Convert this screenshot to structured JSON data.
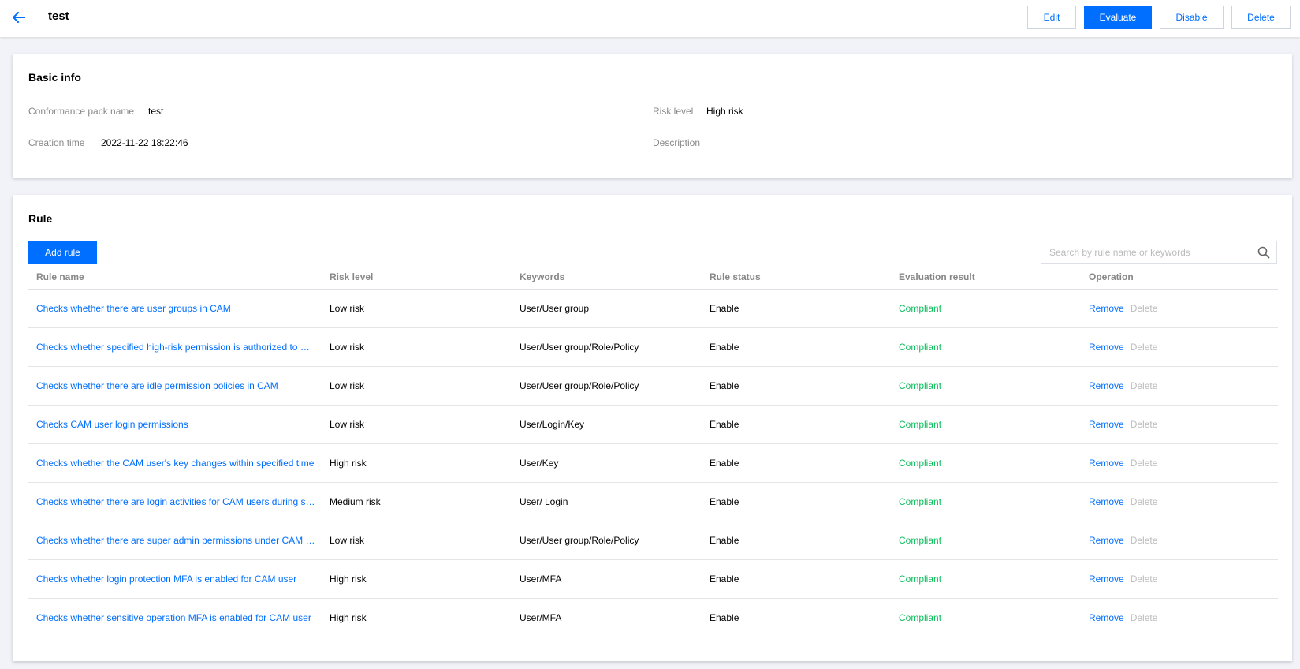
{
  "header": {
    "title": "test",
    "buttons": {
      "edit": "Edit",
      "evaluate": "Evaluate",
      "disable": "Disable",
      "delete": "Delete"
    }
  },
  "basic_info": {
    "title": "Basic info",
    "fields": {
      "pack_name_label": "Conformance pack name",
      "pack_name_value": "test",
      "risk_level_label": "Risk level",
      "risk_level_value": "High risk",
      "creation_time_label": "Creation time",
      "creation_time_value": "2022-11-22 18:22:46",
      "description_label": "Description",
      "description_value": ""
    }
  },
  "rule": {
    "title": "Rule",
    "add_rule_label": "Add rule",
    "search_placeholder": "Search by rule name or keywords",
    "columns": [
      "Rule name",
      "Risk level",
      "Keywords",
      "Rule status",
      "Evaluation result",
      "Operation"
    ],
    "operations": {
      "remove": "Remove",
      "delete": "Delete"
    },
    "rows": [
      {
        "name": "Checks whether there are user groups in CAM",
        "risk": "Low risk",
        "keywords": "User/User group",
        "status": "Enable",
        "result": "Compliant"
      },
      {
        "name": "Checks whether specified high-risk permission is authorized to CA...",
        "risk": "Low risk",
        "keywords": "User/User group/Role/Policy",
        "status": "Enable",
        "result": "Compliant"
      },
      {
        "name": "Checks whether there are idle permission policies in CAM",
        "risk": "Low risk",
        "keywords": "User/User group/Role/Policy",
        "status": "Enable",
        "result": "Compliant"
      },
      {
        "name": "Checks CAM user login permissions",
        "risk": "Low risk",
        "keywords": "User/Login/Key",
        "status": "Enable",
        "result": "Compliant"
      },
      {
        "name": "Checks whether the CAM user's key changes within specified time",
        "risk": "High risk",
        "keywords": "User/Key",
        "status": "Enable",
        "result": "Compliant"
      },
      {
        "name": "Checks whether there are login activities for CAM users during spe...",
        "risk": "Medium risk",
        "keywords": "User/ Login",
        "status": "Enable",
        "result": "Compliant"
      },
      {
        "name": "Checks whether there are super admin permissions under CAM su...",
        "risk": "Low risk",
        "keywords": "User/User group/Role/Policy",
        "status": "Enable",
        "result": "Compliant"
      },
      {
        "name": "Checks whether login protection MFA is enabled for CAM user",
        "risk": "High risk",
        "keywords": "User/MFA",
        "status": "Enable",
        "result": "Compliant"
      },
      {
        "name": "Checks whether sensitive operation MFA is enabled for CAM user",
        "risk": "High risk",
        "keywords": "User/MFA",
        "status": "Enable",
        "result": "Compliant"
      }
    ]
  },
  "colors": {
    "primary": "#006eff",
    "compliant": "#0abf5b",
    "disabled": "#bbbbbb"
  },
  "icons": {
    "back": "arrow-left-icon",
    "search": "search-icon"
  }
}
